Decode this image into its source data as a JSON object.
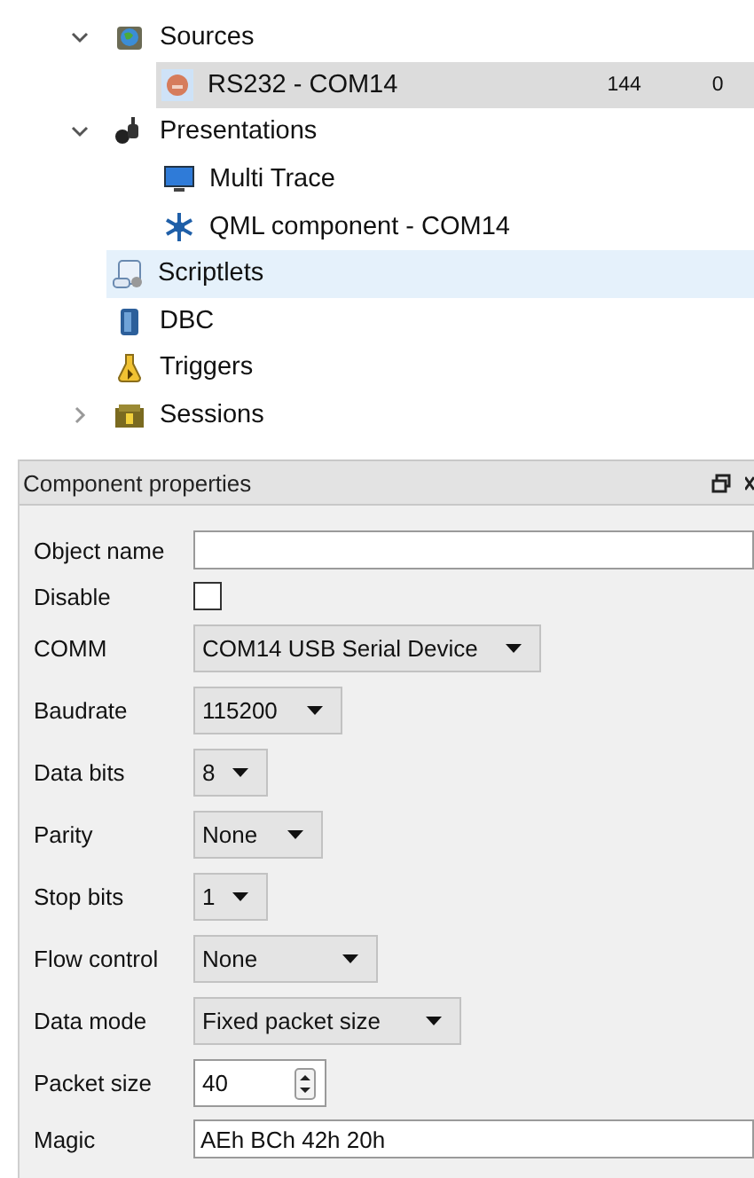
{
  "tree": [
    {
      "label": "Sources",
      "expanded": true,
      "selected": false,
      "highlighted": false,
      "children": [
        {
          "label": "RS232 - COM14",
          "selected": true,
          "highlighted": false,
          "column_2": "144",
          "column_3": "0"
        }
      ]
    },
    {
      "label": "Presentations",
      "expanded": true,
      "selected": false,
      "highlighted": false,
      "children": [
        {
          "label": "Multi Trace",
          "selected": false,
          "highlighted": false
        },
        {
          "label": "QML component - COM14",
          "selected": false,
          "highlighted": false
        }
      ]
    },
    {
      "label": "Scriptlets",
      "selected": false,
      "highlighted": true
    },
    {
      "label": "DBC",
      "selected": false,
      "highlighted": false
    },
    {
      "label": "Triggers",
      "selected": false,
      "highlighted": false
    },
    {
      "label": "Sessions",
      "expanded": false,
      "selected": false,
      "highlighted": false
    }
  ],
  "panel": {
    "title": "Component properties",
    "fields": [
      {
        "kind": "text",
        "label": "Object name"
      },
      {
        "kind": "checkbox",
        "label": "Disable",
        "checked": false
      },
      {
        "kind": "dropdown",
        "label": "COMM",
        "value": "COM14 USB Serial Device"
      },
      {
        "kind": "dropdown",
        "label": "Baudrate",
        "value": "115200"
      },
      {
        "kind": "dropdown",
        "label": "Data bits",
        "value": "8"
      },
      {
        "kind": "dropdown",
        "label": "Parity",
        "value": "None"
      },
      {
        "kind": "dropdown",
        "label": "Stop bits",
        "value": "1"
      },
      {
        "kind": "dropdown",
        "label": "Flow control",
        "value": "None"
      },
      {
        "kind": "dropdown",
        "label": "Data mode",
        "value": "Fixed packet size"
      },
      {
        "kind": "spinbox",
        "label": "Packet size",
        "value": "40"
      },
      {
        "kind": "text",
        "label": "Magic",
        "value": "AEh BCh 42h 20h"
      }
    ]
  }
}
